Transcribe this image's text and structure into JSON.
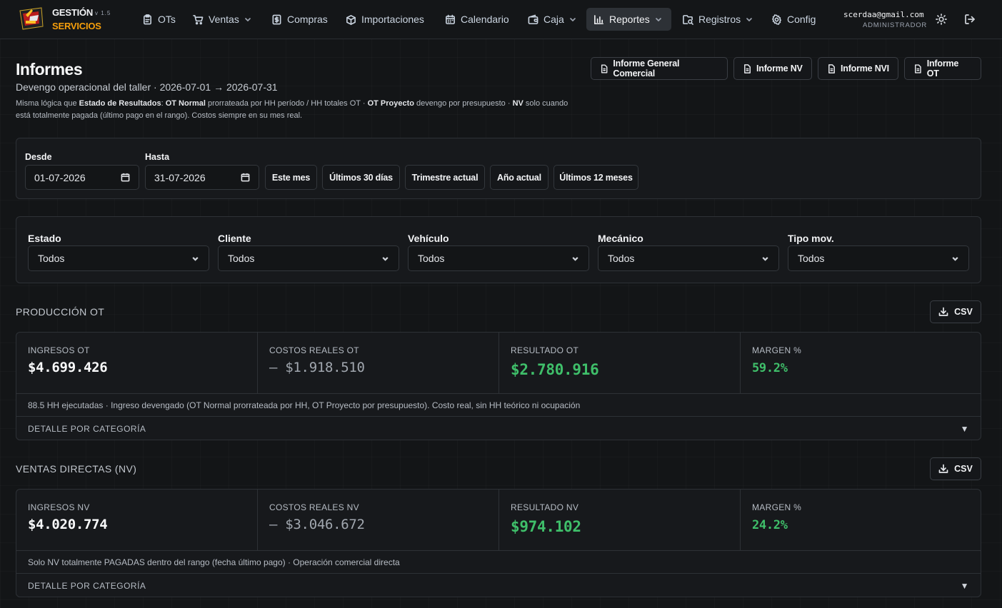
{
  "brand": {
    "line1": "GESTIÓN",
    "version": "v 1.5",
    "line2": "SERVICIOS",
    "accent_color": "#f59e0b"
  },
  "nav": {
    "items": [
      {
        "label": "OTs",
        "icon": "clipboard-icon",
        "dropdown": false
      },
      {
        "label": "Ventas",
        "icon": "cart-icon",
        "dropdown": true
      },
      {
        "label": "Compras",
        "icon": "dollar-doc-icon",
        "dropdown": false
      },
      {
        "label": "Importaciones",
        "icon": "package-icon",
        "dropdown": false
      },
      {
        "label": "Calendario",
        "icon": "calendar-icon",
        "dropdown": false
      },
      {
        "label": "Caja",
        "icon": "wallet-icon",
        "dropdown": true
      },
      {
        "label": "Reportes",
        "icon": "bar-chart-icon",
        "dropdown": true,
        "active": true
      },
      {
        "label": "Registros",
        "icon": "folder-search-icon",
        "dropdown": true
      },
      {
        "label": "Config",
        "icon": "gear-icon",
        "dropdown": false
      }
    ]
  },
  "user": {
    "email": "scerdaa@gmail.com",
    "role": "ADMINISTRADOR"
  },
  "header": {
    "title": "Informes",
    "subtitle": "Devengo operacional del taller · 2026-07-01 → 2026-07-31",
    "desc_1": "Misma lógica que ",
    "desc_b1": "Estado de Resultados",
    "desc_2": ": ",
    "desc_b2": "OT Normal",
    "desc_3": " prorrateada por HH período / HH totales OT · ",
    "desc_b3": "OT Proyecto",
    "desc_4": " devengo por presupuesto · ",
    "desc_b4": "NV",
    "desc_5": " solo cuando está totalmente pagada (último pago en el rango). Costos siempre en su mes real."
  },
  "report_buttons": {
    "general": "Informe General Comercial",
    "nv": "Informe NV",
    "nvi": "Informe NVI",
    "ot": "Informe OT"
  },
  "date_filter": {
    "from_label": "Desde",
    "from_value": "01-07-2026",
    "to_label": "Hasta",
    "to_value": "31-07-2026",
    "quick": [
      "Este mes",
      "Últimos 30 días",
      "Trimestre actual",
      "Año actual",
      "Últimos 12 meses"
    ]
  },
  "filters": [
    {
      "label": "Estado",
      "value": "Todos"
    },
    {
      "label": "Cliente",
      "value": "Todos"
    },
    {
      "label": "Vehículo",
      "value": "Todos"
    },
    {
      "label": "Mecánico",
      "value": "Todos"
    },
    {
      "label": "Tipo mov.",
      "value": "Todos"
    }
  ],
  "sections": {
    "ot": {
      "title": "PRODUCCIÓN OT",
      "csv": "CSV",
      "metrics": [
        {
          "label": "INGRESOS OT",
          "value": "$4.699.426"
        },
        {
          "label": "COSTOS REALES OT",
          "value": "– $1.918.510"
        },
        {
          "label": "RESULTADO OT",
          "value": "$2.780.916"
        },
        {
          "label": "MARGEN %",
          "value": "59.2%"
        }
      ],
      "note": "88.5 HH ejecutadas · Ingreso devengado (OT Normal prorrateada por HH, OT Proyecto por presupuesto). Costo real, sin HH teórico ni ocupación",
      "detail": "DETALLE POR CATEGORÍA"
    },
    "nv": {
      "title": "VENTAS DIRECTAS (NV)",
      "csv": "CSV",
      "metrics": [
        {
          "label": "INGRESOS NV",
          "value": "$4.020.774"
        },
        {
          "label": "COSTOS REALES NV",
          "value": "– $3.046.672"
        },
        {
          "label": "RESULTADO NV",
          "value": "$974.102"
        },
        {
          "label": "MARGEN %",
          "value": "24.2%"
        }
      ],
      "note": "Solo NV totalmente PAGADAS dentro del rango (fecha último pago) · Operación comercial directa",
      "detail": "DETALLE POR CATEGORÍA"
    }
  },
  "colors": {
    "positive": "#3fbf6a",
    "active_nav": "#2d3136"
  }
}
